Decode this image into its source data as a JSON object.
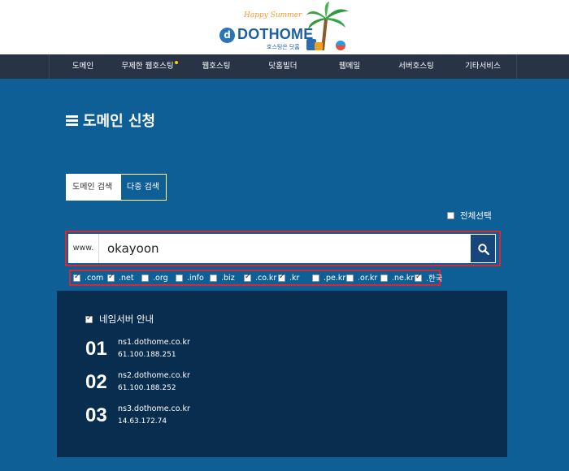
{
  "header": {
    "tagline": "Happy Summer",
    "logo_letter": "d",
    "brand": "DOTHOME",
    "brand_sub": "호스팅은 닷홈"
  },
  "nav": {
    "items": [
      {
        "label": "도메인"
      },
      {
        "label": "무제한 웹호스팅",
        "badge_dot": true
      },
      {
        "label": "웹호스팅"
      },
      {
        "label": "닷홈빌더"
      },
      {
        "label": "웹메일"
      },
      {
        "label": "서버호스팅"
      },
      {
        "label": "기타서비스"
      }
    ]
  },
  "page": {
    "title": "도메인 신청"
  },
  "tabs": [
    {
      "label": "도메인 검색",
      "active": true
    },
    {
      "label": "다중 검색",
      "active": false
    }
  ],
  "select_all": {
    "label": "전체선택",
    "checked": false
  },
  "search": {
    "prefix": "www.",
    "value": "okayoon",
    "button_icon": "search-icon"
  },
  "tlds": [
    {
      "label": ".com",
      "checked": true
    },
    {
      "label": ".net",
      "checked": true
    },
    {
      "label": ".org",
      "checked": false
    },
    {
      "label": ".info",
      "checked": false
    },
    {
      "label": ".biz",
      "checked": false
    },
    {
      "label": ".co.kr",
      "checked": true
    },
    {
      "label": ".kr",
      "checked": true
    },
    {
      "label": ".pe.kr",
      "checked": false
    },
    {
      "label": ".or.kr",
      "checked": false
    },
    {
      "label": ".ne.kr",
      "checked": false
    },
    {
      "label": ".한국",
      "checked": true
    }
  ],
  "nameservers": {
    "title": "네임서버 안내",
    "checked": true,
    "entries": [
      {
        "num": "01",
        "host": "ns1.dothome.co.kr",
        "ip": "61.100.188.251"
      },
      {
        "num": "02",
        "host": "ns2.dothome.co.kr",
        "ip": "61.100.188.252"
      },
      {
        "num": "03",
        "host": "ns3.dothome.co.kr",
        "ip": "14.63.172.74"
      }
    ]
  },
  "colors": {
    "main_bg": "#0f5f97",
    "nav_bg": "#283446",
    "panel_bg": "#082d4e",
    "highlight_outline": "#d7282f",
    "brand_blue": "#1d5fa4"
  }
}
